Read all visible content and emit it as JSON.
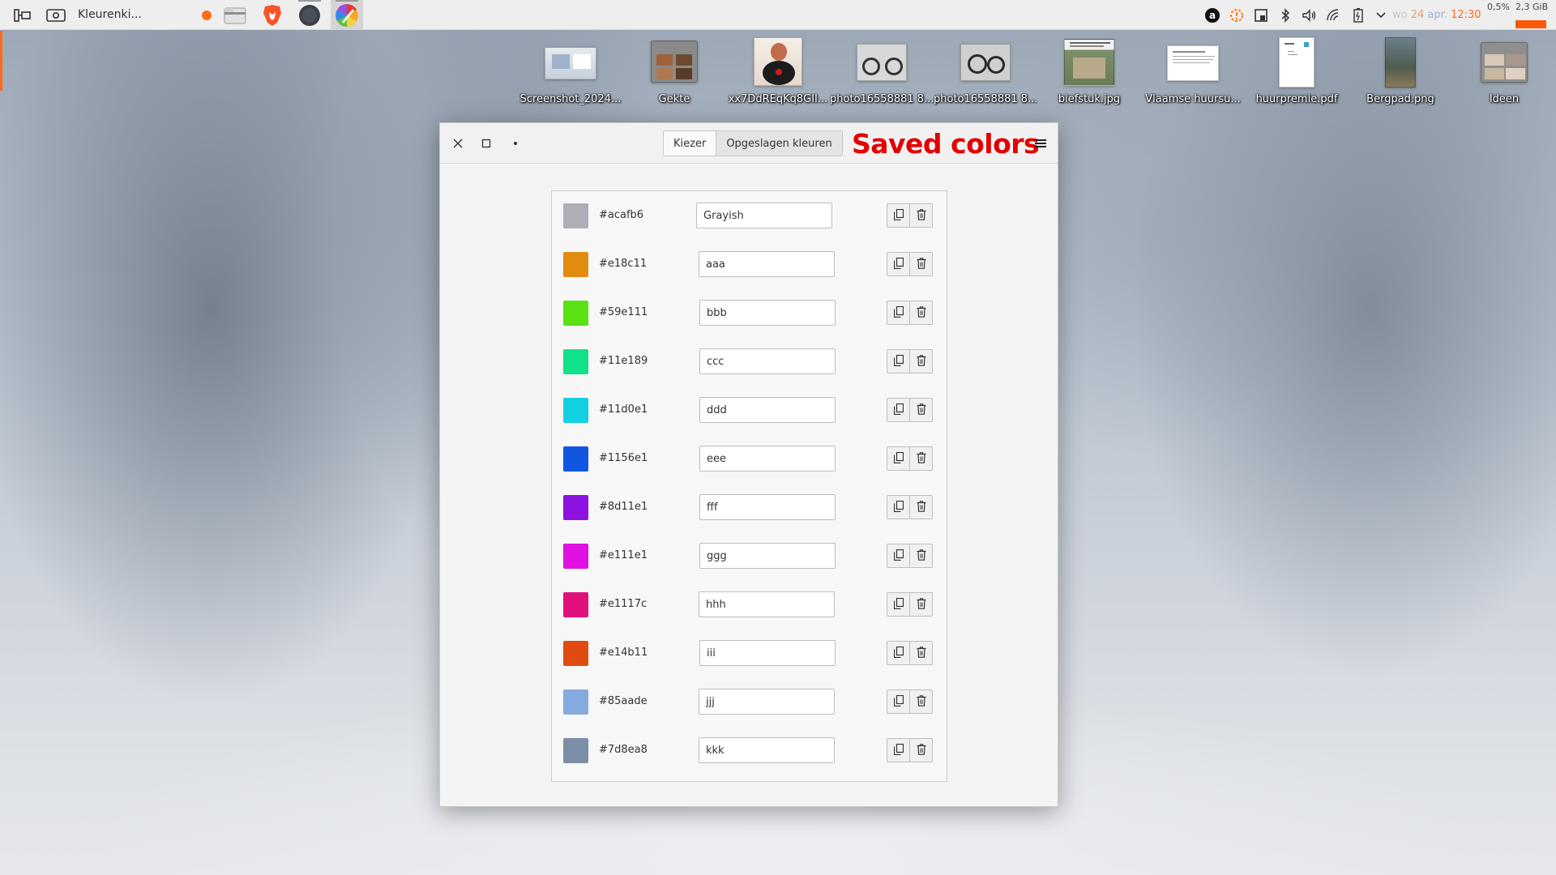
{
  "taskbar": {
    "app_title": "Kleurenki...",
    "clock": {
      "day": "wo",
      "date": "24",
      "month": "apr.",
      "time": "12:30"
    },
    "cpu": "0,5%",
    "memory": "2,3 GiB"
  },
  "desktop_icons": [
    {
      "label": "Screenshot_2024...",
      "thumb": "screenshot"
    },
    {
      "label": "Gekte",
      "thumb": "folder"
    },
    {
      "label": "xx7DdREqKq8GII...",
      "thumb": "photo-woman"
    },
    {
      "label": "photo16558881 8...",
      "thumb": "photo-bike"
    },
    {
      "label": "photo16558881 8...",
      "thumb": "photo-bike"
    },
    {
      "label": "biefstuk.jpg",
      "thumb": "photo-house"
    },
    {
      "label": "Vlaamse huursu...",
      "thumb": "document"
    },
    {
      "label": "huurpremie.pdf",
      "thumb": "pdf"
    },
    {
      "label": "Bergpad.png",
      "thumb": "photo-mountain"
    },
    {
      "label": "Ideen",
      "thumb": "folder-photos"
    }
  ],
  "window": {
    "tabs": [
      {
        "label": "Kiezer"
      },
      {
        "label": "Opgeslagen kleuren"
      }
    ],
    "heading": "Saved colors",
    "colors": [
      {
        "hex": "#acafb6",
        "name": "Grayish"
      },
      {
        "hex": "#e18c11",
        "name": "aaa"
      },
      {
        "hex": "#59e111",
        "name": "bbb"
      },
      {
        "hex": "#11e189",
        "name": "ccc"
      },
      {
        "hex": "#11d0e1",
        "name": "ddd"
      },
      {
        "hex": "#1156e1",
        "name": "eee"
      },
      {
        "hex": "#8d11e1",
        "name": "fff"
      },
      {
        "hex": "#e111e1",
        "name": "ggg"
      },
      {
        "hex": "#e1117c",
        "name": "hhh"
      },
      {
        "hex": "#e14b11",
        "name": "iii"
      },
      {
        "hex": "#85aade",
        "name": "jjj"
      },
      {
        "hex": "#7d8ea8",
        "name": "kkk"
      }
    ]
  },
  "icons": {
    "window_close": "close-icon",
    "window_maximize": "maximize-icon",
    "window_minimize": "minimize-icon",
    "menu": "hamburger-menu-icon",
    "copy": "copy-icon",
    "delete": "trash-icon"
  }
}
